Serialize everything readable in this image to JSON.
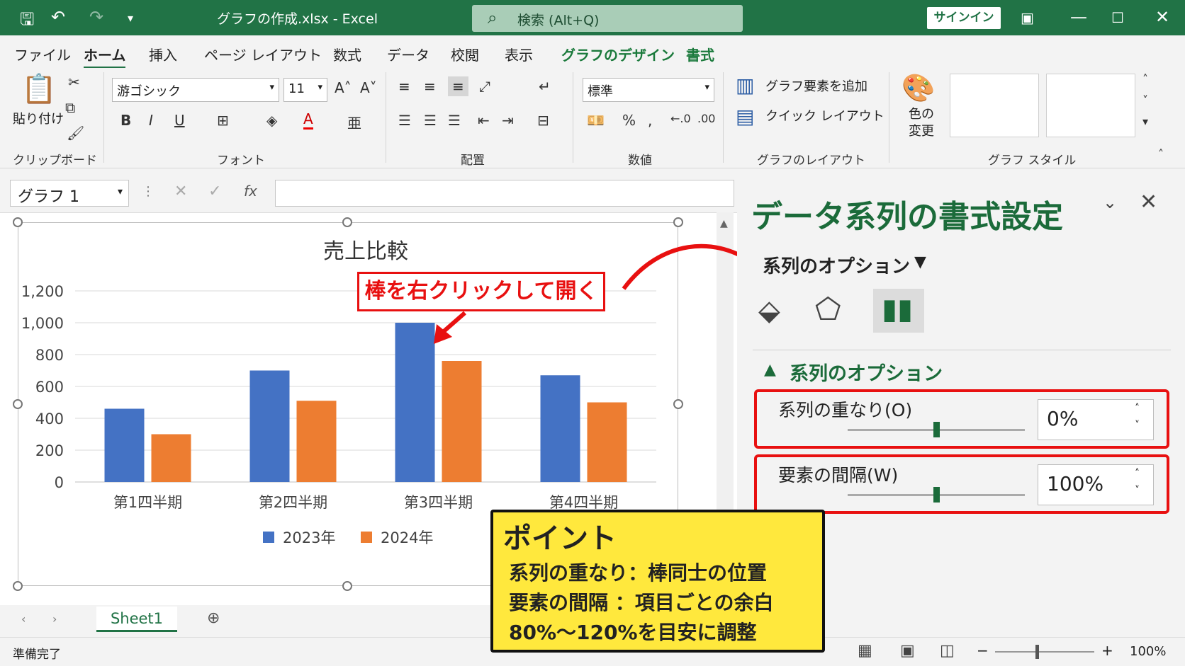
{
  "titlebar": {
    "doc_title": "グラフの作成.xlsx  -  Excel",
    "search_label": "検索 (Alt+Q)",
    "signin_label": "サインイン"
  },
  "tabs": [
    "ファイル",
    "ホーム",
    "挿入",
    "ページ レイアウト",
    "数式",
    "データ",
    "校閲",
    "表示",
    "グラフのデザイン",
    "書式"
  ],
  "ribbon": {
    "paste_label": "貼り付け",
    "clipboard_label": "クリップボード",
    "font_name": "游ゴシック",
    "font_size": "11",
    "font_label": "フォント",
    "align_label": "配置",
    "number_format": "標準",
    "number_label": "数値",
    "add_element_label": "グラフ要素を追加",
    "quick_layout_label": "クイック レイアウト",
    "layout_group_label": "グラフのレイアウト",
    "color_change_label": "色の変更",
    "style_group_label": "グラフ スタイル"
  },
  "formula_bar": {
    "name_box": "グラフ 1",
    "fx": "fx"
  },
  "chart_data": {
    "type": "bar",
    "title": "売上比較",
    "categories": [
      "第1四半期",
      "第2四半期",
      "第3四半期",
      "第4四半期"
    ],
    "series": [
      {
        "name": "2023年",
        "color": "#4472c4",
        "values": [
          460,
          700,
          1000,
          670
        ]
      },
      {
        "name": "2024年",
        "color": "#ed7d31",
        "values": [
          300,
          510,
          760,
          500
        ]
      }
    ],
    "ylim": [
      0,
      1200
    ],
    "yticks": [
      "0",
      "200",
      "400",
      "600",
      "800",
      "1,000",
      "1,200"
    ],
    "grid": true,
    "legend": "bottom"
  },
  "callout": {
    "text": "棒を右クリックして開く"
  },
  "pane": {
    "title": "データ系列の書式設定",
    "options_dropdown": "系列のオプション",
    "section_title": "系列のオプション",
    "overlap_label": "系列の重なり(O)",
    "overlap_value": "0%",
    "overlap_fraction": 0.5,
    "gap_label": "要素の間隔(W)",
    "gap_value": "100%",
    "gap_fraction": 0.5
  },
  "point": {
    "heading": "ポイント",
    "line1": "系列の重なり：棒同士の位置",
    "line2": "要素の間隔 ：項目ごとの余白",
    "line3": "80%～120%を目安に調整"
  },
  "sheet_tab": "Sheet1",
  "status": {
    "ready": "準備完了",
    "zoom": "100%"
  },
  "colors": {
    "excel_green": "#217346",
    "accent_red": "#e81010",
    "note_yellow": "#ffe83d"
  }
}
